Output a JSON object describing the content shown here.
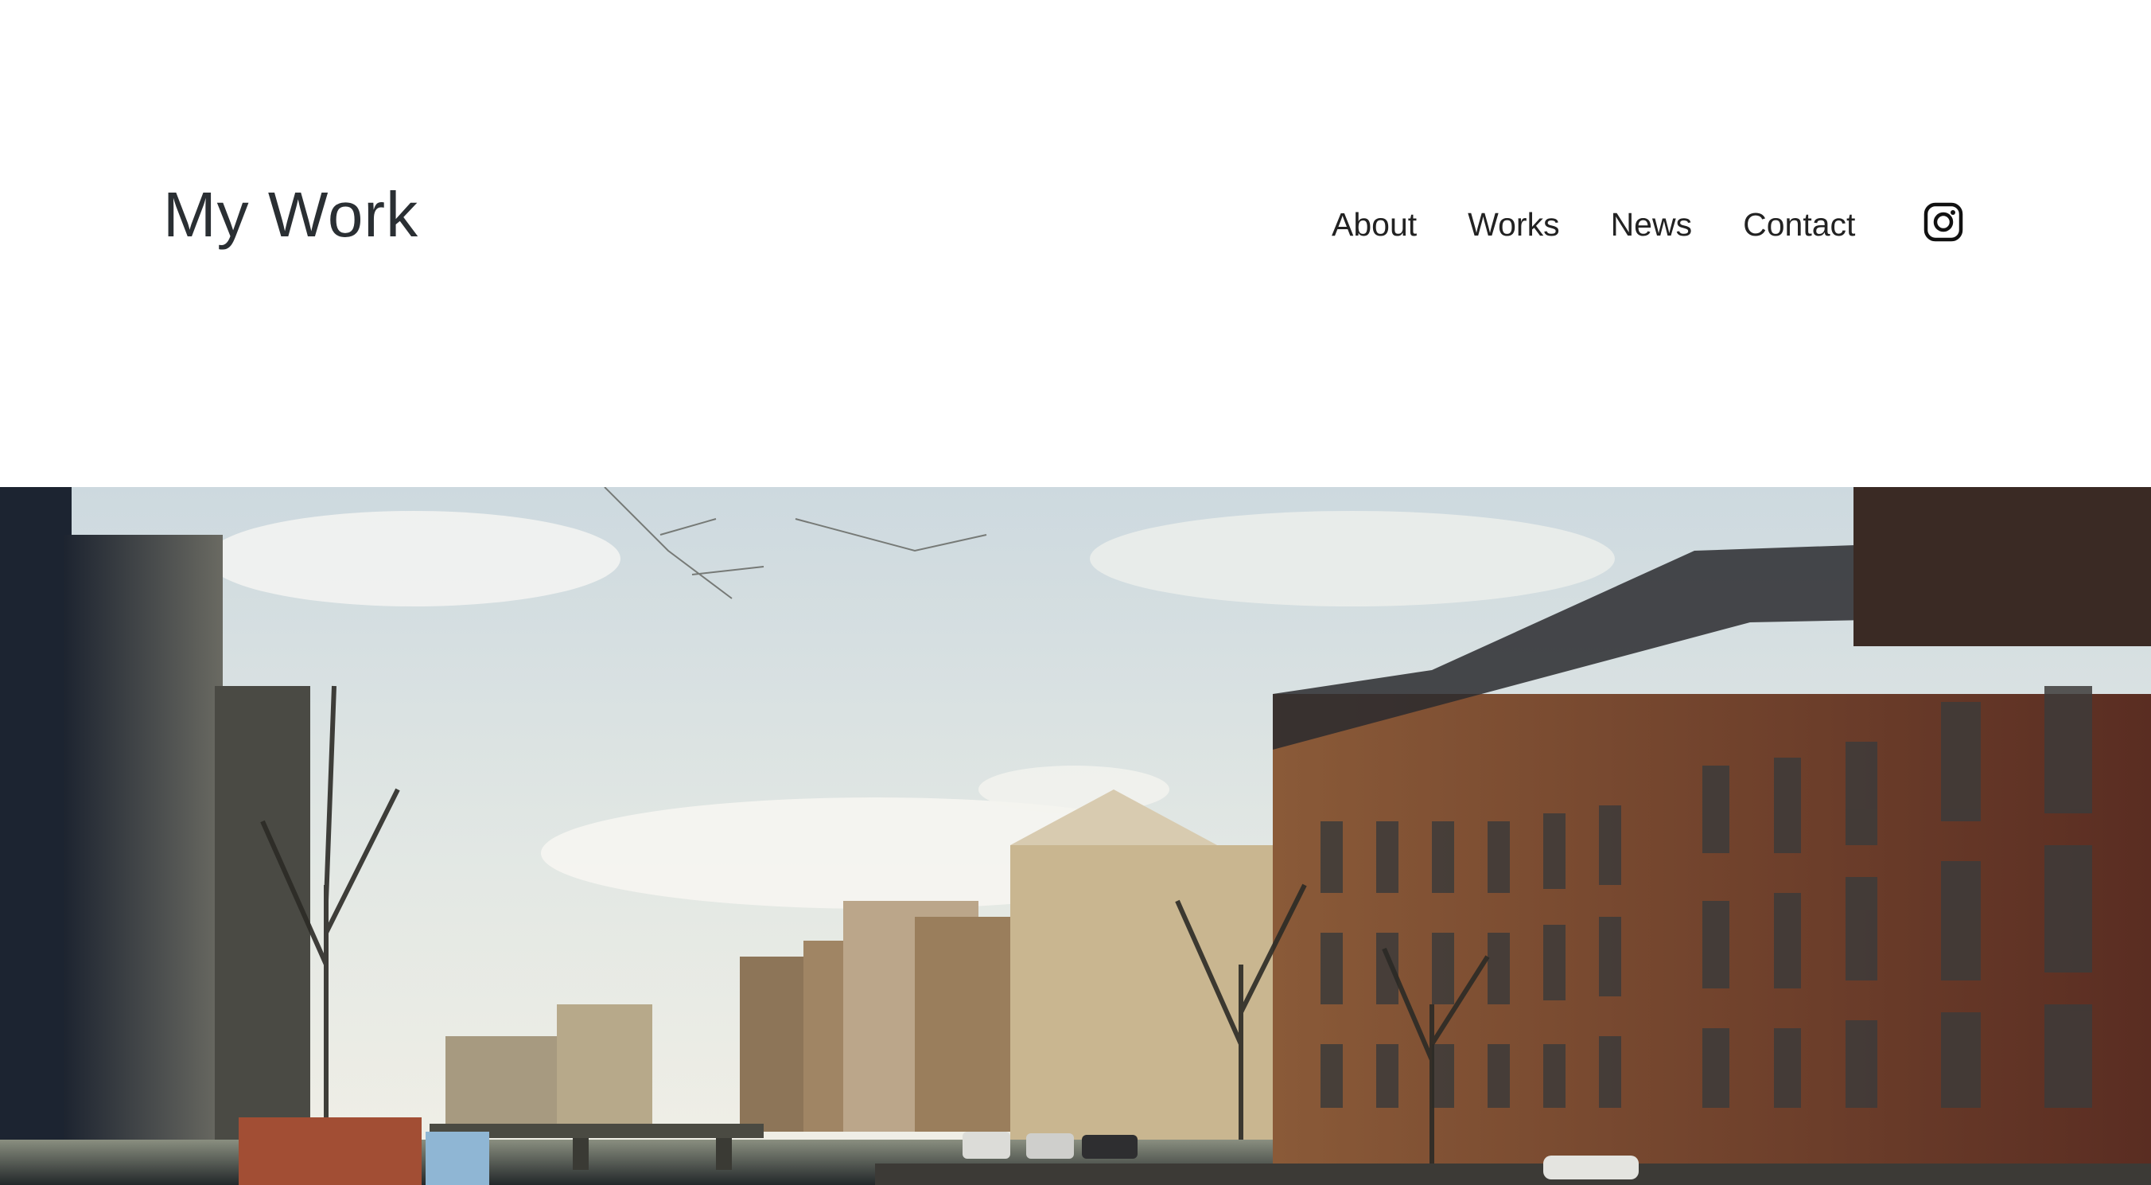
{
  "site": {
    "logo_text": "My Work"
  },
  "nav": {
    "items": [
      {
        "label": "About"
      },
      {
        "label": "Works"
      },
      {
        "label": "News"
      },
      {
        "label": "Contact"
      }
    ],
    "social_icon": "instagram-icon"
  },
  "hero": {
    "image_subject": "canal-street-photo",
    "colors": {
      "sky": "#d8e2e6",
      "brick": "#6e3b2a",
      "facade": "#b08a5a",
      "water": "#2f3a36"
    }
  }
}
